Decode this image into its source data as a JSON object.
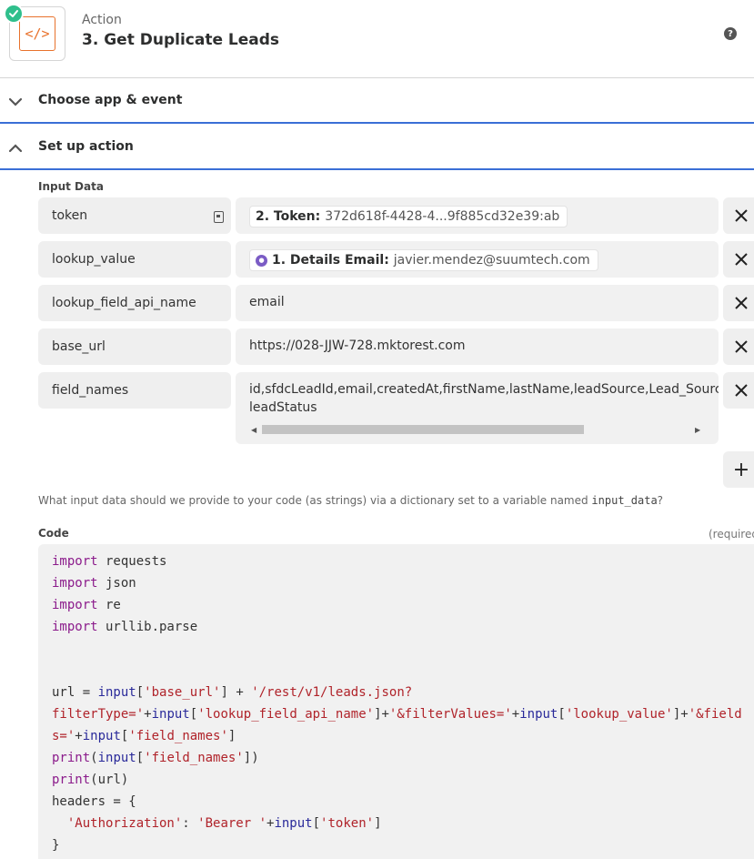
{
  "header": {
    "kind": "Action",
    "title": "3. Get Duplicate Leads",
    "icon_glyph": "</>",
    "help_glyph": "?"
  },
  "sections": {
    "choose": "Choose app & event",
    "setup": "Set up action"
  },
  "input_data": {
    "label": "Input Data",
    "rows": [
      {
        "key": "token",
        "pill_key": "2. Token:",
        "pill_value": "372d618f-4428-4...9f885cd32e39:ab"
      },
      {
        "key": "lookup_value",
        "pill_key": "1. Details Email:",
        "pill_value": "javier.mendez@suumtech.com"
      },
      {
        "key": "lookup_field_api_name",
        "value": "email"
      },
      {
        "key": "base_url",
        "value": "https://028-JJW-728.mktorest.com"
      },
      {
        "key": "field_names",
        "value_line1": "id,sfdcLeadId,email,createdAt,firstName,lastName,leadSource,Lead_Source",
        "value_line2": "leadStatus"
      }
    ],
    "add_glyph": "+"
  },
  "help_text": {
    "before": "What input data should we provide to your code (as strings) via a dictionary set to a variable named ",
    "mono": "input_data",
    "after": "?"
  },
  "code": {
    "label": "Code",
    "required": "(required)",
    "l1": [
      "import",
      " requests"
    ],
    "l2": [
      "import",
      " json"
    ],
    "l3": [
      "import",
      " re"
    ],
    "l4": [
      "import",
      " urllib.parse"
    ],
    "l7": [
      "url = ",
      "input",
      "[",
      "'base_url'",
      "] + ",
      "'/rest/v1/leads.json?"
    ],
    "l8": [
      "filterType='",
      "+",
      "input",
      "[",
      "'lookup_field_api_name'",
      "]+",
      "'&filterValues='",
      "+",
      "input",
      "[",
      "'lookup_value'",
      "]+",
      "'&field"
    ],
    "l9": [
      "s='",
      "+",
      "input",
      "[",
      "'field_names'",
      "]"
    ],
    "l10": [
      "print",
      "(",
      "input",
      "[",
      "'field_names'",
      "])"
    ],
    "l11": [
      "print",
      "(url)"
    ],
    "l12": [
      "headers = {"
    ],
    "l13": [
      "  ",
      "'Authorization'",
      ": ",
      "'Bearer '",
      "+",
      "input",
      "[",
      "'token'",
      "]"
    ],
    "l14": [
      "}"
    ]
  },
  "colors": {
    "accent_blue": "#3a6fd6",
    "success_green": "#2fbf8c",
    "code_orange": "#e8722c",
    "keyword": "#8b1b8b",
    "string": "#b0232a",
    "builtin": "#2a2a9a"
  },
  "icons": {
    "app": "code-brackets-icon",
    "check": "check-circle-icon",
    "help": "question-circle-icon",
    "collapse": "chevron-icon",
    "key": "key-icon",
    "remove": "x-icon",
    "add": "plus-icon"
  }
}
